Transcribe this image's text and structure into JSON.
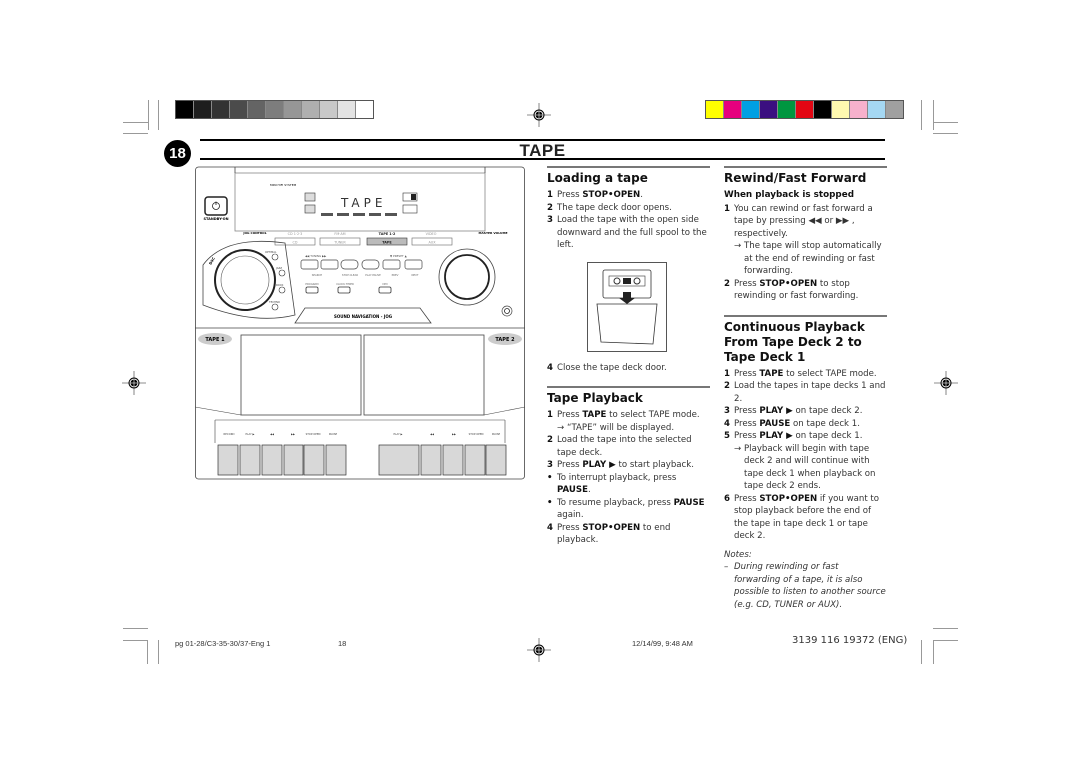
{
  "colorbar_left": [
    "#000000",
    "#1e1e1e",
    "#333333",
    "#4b4b4b",
    "#646464",
    "#7d7d7d",
    "#969696",
    "#afafaf",
    "#c8c8c8",
    "#e3e3e3",
    "#ffffff"
  ],
  "colorbar_right": [
    "#ffff00",
    "#e6007e",
    "#00a0e3",
    "#3b0f80",
    "#009640",
    "#e30613",
    "#000000",
    "#fff9b0",
    "#f7b1cc",
    "#a5d8f3",
    "#a0a0a0"
  ],
  "header": {
    "page_number": "18",
    "title": "TAPE"
  },
  "loading": {
    "title": "Loading a tape",
    "steps": [
      {
        "n": "1",
        "pre": "Press ",
        "bold": "STOP•OPEN",
        "post": "."
      },
      {
        "n": "2",
        "text": "The tape deck door opens."
      },
      {
        "n": "3",
        "text": "Load the tape with the open side downward and the full spool to the left."
      },
      {
        "n": "4",
        "text": "Close the tape deck door."
      }
    ]
  },
  "playback": {
    "title": "Tape Playback",
    "s1_pre": "Press ",
    "s1_bold": "TAPE",
    "s1_post": " to select TAPE mode.",
    "s1_arrow": "“TAPE” will be displayed.",
    "s2": "Load the tape into the selected tape deck.",
    "s3_pre": "Press ",
    "s3_bold": "PLAY ▶",
    "s3_post": " to start playback.",
    "b1_pre": "To interrupt playback, press ",
    "b1_bold": "PAUSE",
    "b1_post": ".",
    "b2_pre": "To resume playback, press ",
    "b2_bold": "PAUSE",
    "b2_post": " again.",
    "s4_pre": "Press ",
    "s4_bold": "STOP•OPEN",
    "s4_post": " to end playback."
  },
  "rewind": {
    "title": "Rewind/Fast Forward",
    "subtitle": "When playback is stopped",
    "s1": "You can rewind or fast forward a tape by pressing ◀◀ or ▶▶ , respectively.",
    "s1_arrow": "The tape will stop automatically at the end of rewinding or fast forwarding.",
    "s2_pre": "Press ",
    "s2_bold": "STOP•OPEN",
    "s2_post": " to stop rewinding or fast forwarding."
  },
  "continuous": {
    "title": "Continuous Playback From Tape Deck 2 to Tape Deck 1",
    "s1_pre": "Press ",
    "s1_bold": "TAPE",
    "s1_post": " to select TAPE mode.",
    "s2": "Load the tapes in tape decks 1 and 2.",
    "s3_pre": "Press ",
    "s3_bold": "PLAY ▶",
    "s3_post": " on tape deck 2.",
    "s4_pre": "Press ",
    "s4_bold": "PAUSE",
    "s4_post": " on tape deck 1.",
    "s5_pre": "Press ",
    "s5_bold": "PLAY ▶",
    "s5_post": " on tape deck 1.",
    "s5_arrow": "Playback will begin with tape deck 2 and will continue with tape deck 1 when playback on tape deck 2 ends.",
    "s6_pre": "Press ",
    "s6_bold": "STOP•OPEN",
    "s6_post": " if you want to stop playback before the end of the tape in tape deck 1 or tape deck 2.",
    "notes_label": "Notes:",
    "note1": "During rewinding or fast forwarding of a tape, it is also possible to listen to another source (e.g. CD, TUNER or AUX)."
  },
  "device": {
    "system_label": "MINI HIFI SYSTEM",
    "display_text": "TAPE",
    "standby": "STANDBY-ON",
    "jog_control": "JOG CONTROL",
    "master_volume": "MASTER VOLUME",
    "sources": [
      "CD 1·2·3",
      "FM·AM",
      "TAPE 1·2",
      "VIDEO"
    ],
    "source_buttons": [
      "CD",
      "TUNER",
      "TAPE",
      "AUX"
    ],
    "tuning": "◀◀ TUNING ▶▶",
    "preset": "▼ PRESET ▲",
    "transport_labels": [
      "SEARCH",
      "STOP·CLEAR",
      "PLAY·PAUSE",
      "PREV",
      "NEXT"
    ],
    "small_buttons": [
      "PROGRAM",
      "CLOCK·TIMER",
      "DIM"
    ],
    "jog_presets": [
      "OPTIMAL",
      "JAZZ",
      "ROCK",
      "TECHNO"
    ],
    "dsc": "DSC",
    "sound_nav": "SOUND NAVIGATION - JOG",
    "tape1": "TAPE 1",
    "tape2": "TAPE 2",
    "deck1_keys": [
      "RECORD",
      "PLAY ▶",
      "◀◀",
      "▶▶",
      "STOP·OPEN",
      "PAUSE"
    ],
    "deck2_keys": [
      "PLAY ▶",
      "◀◀",
      "▶▶",
      "STOP·OPEN",
      "PAUSE"
    ]
  },
  "footer": {
    "file": "pg 01-28/C3-35-30/37-Eng 1",
    "page": "18",
    "date": "12/14/99, 9:48 AM",
    "code": "3139 116 19372 (ENG)"
  }
}
